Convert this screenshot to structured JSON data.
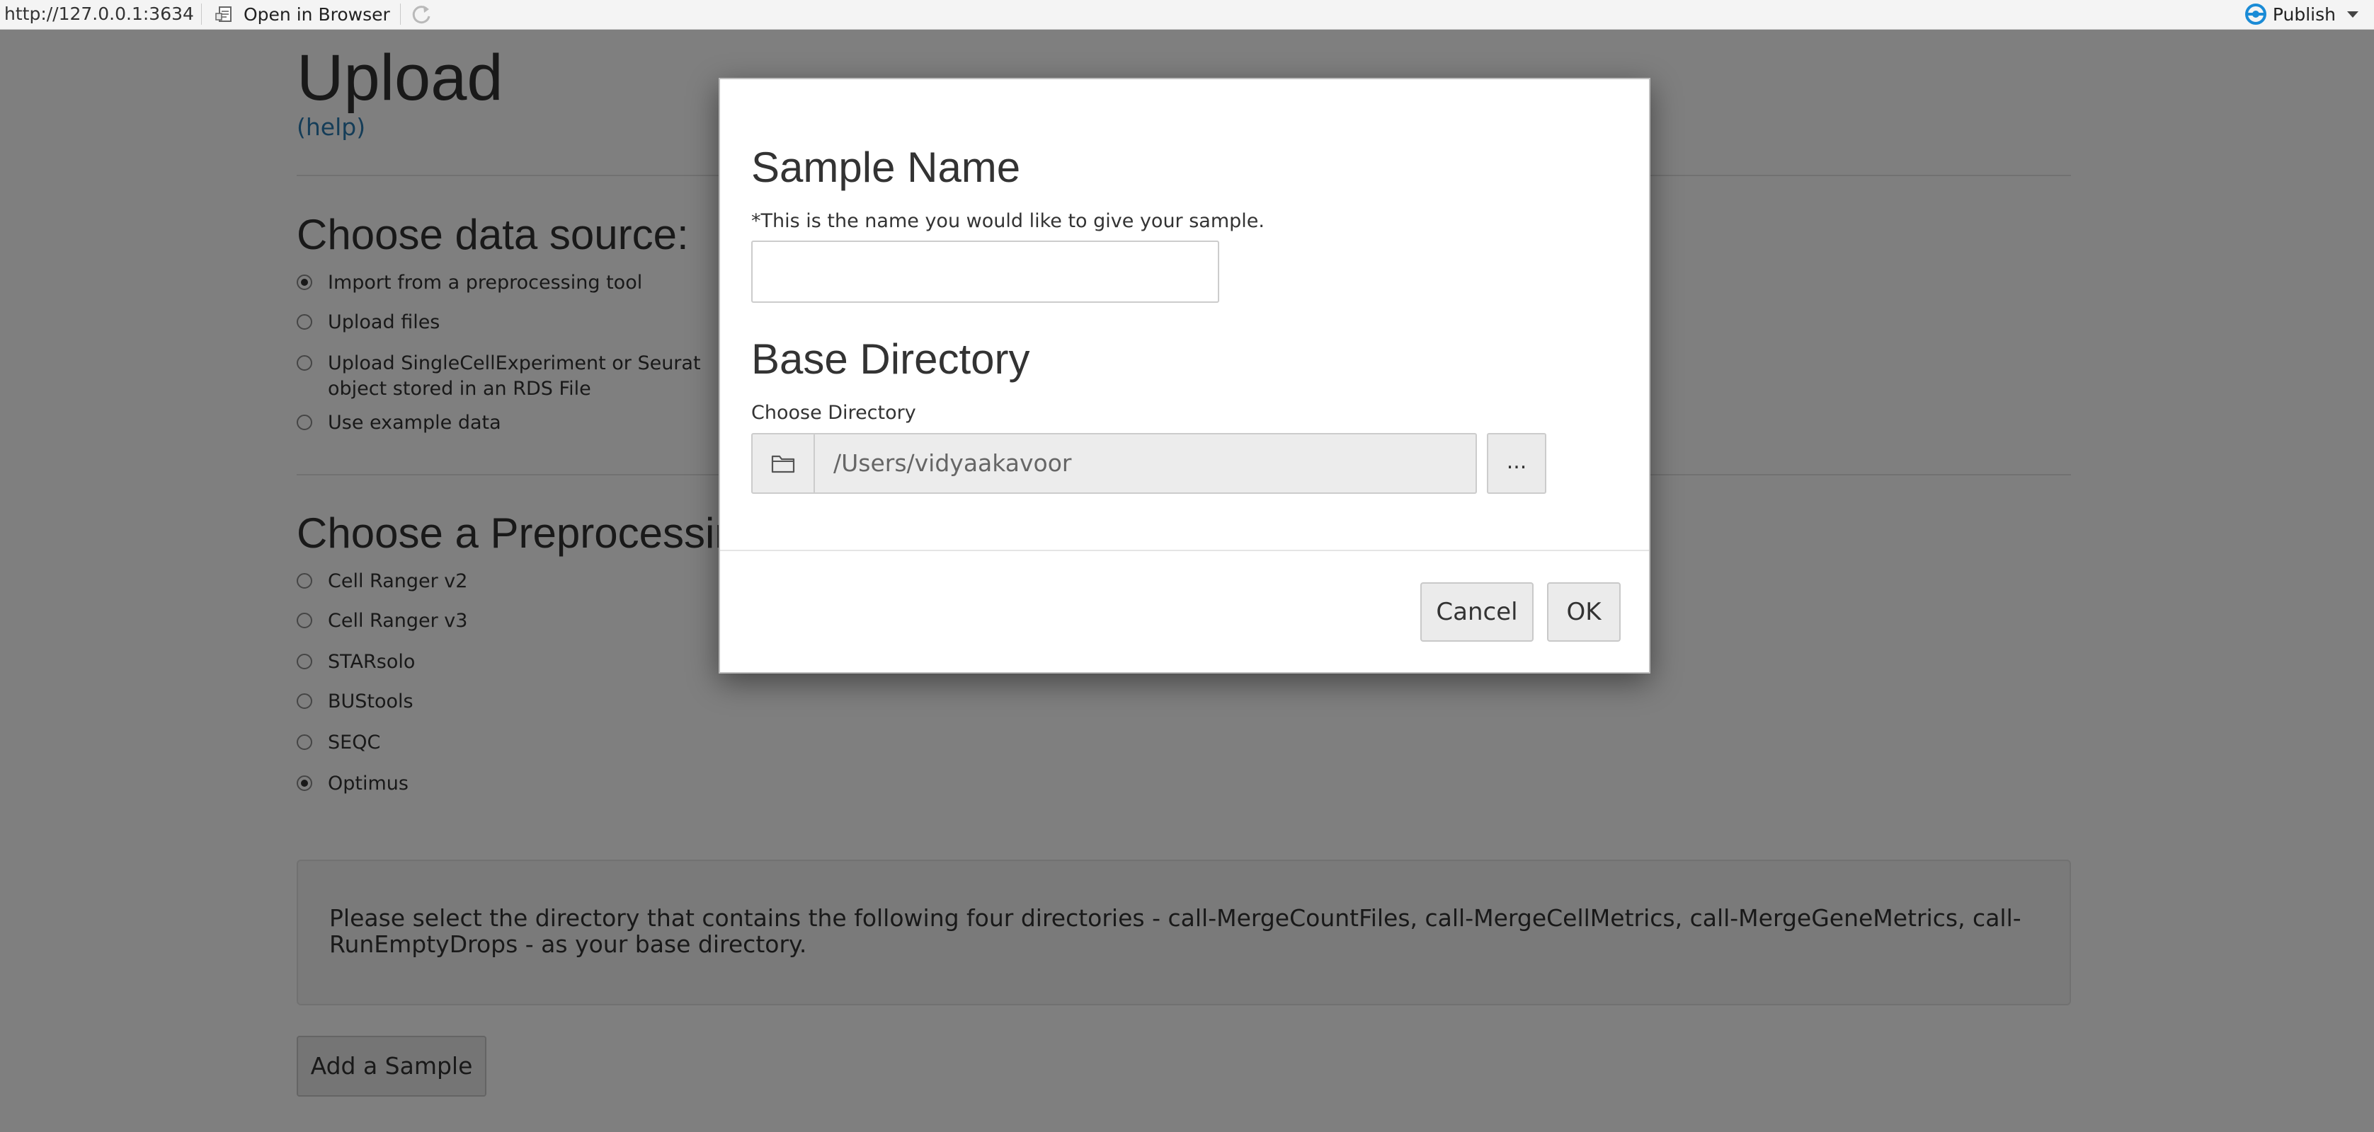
{
  "toolbar": {
    "url": "http://127.0.0.1:3634",
    "open_in_browser": "Open in Browser",
    "publish": "Publish"
  },
  "page": {
    "title": "Upload",
    "help_link": "(help)",
    "data_source": {
      "heading": "Choose data source:",
      "options": [
        {
          "label": "Import from a preprocessing tool",
          "checked": true
        },
        {
          "label": "Upload files",
          "checked": false
        },
        {
          "label": "Upload SingleCellExperiment or Seurat object stored in an RDS File",
          "checked": false
        },
        {
          "label": "Use example data",
          "checked": false
        }
      ]
    },
    "preprocessing": {
      "heading": "Choose a Preprocessing Tool:",
      "options": [
        {
          "label": "Cell Ranger v2",
          "checked": false
        },
        {
          "label": "Cell Ranger v3",
          "checked": false
        },
        {
          "label": "STARsolo",
          "checked": false
        },
        {
          "label": "BUStools",
          "checked": false
        },
        {
          "label": "SEQC",
          "checked": false
        },
        {
          "label": "Optimus",
          "checked": true
        }
      ]
    },
    "instructions": "Please select the directory that contains the following four directories - call-MergeCountFiles, call-MergeCellMetrics, call-MergeGeneMetrics, call-RunEmptyDrops - as your base directory.",
    "add_sample_button": "Add a Sample"
  },
  "modal": {
    "sample_name_heading": "Sample Name",
    "sample_name_hint": "*This is the name you would like to give your sample.",
    "sample_name_value": "",
    "base_dir_heading": "Base Directory",
    "choose_dir_label": "Choose Directory",
    "dir_path": "/Users/vidyaakavoor",
    "browse_button": "...",
    "cancel_button": "Cancel",
    "ok_button": "OK"
  },
  "colors": {
    "link": "#2a7ab0",
    "backdrop": "rgba(0,0,0,0.5)",
    "publish_icon": "#1a8bd6"
  },
  "icons": [
    "document-icon",
    "refresh-icon",
    "publish-icon",
    "folder-icon"
  ]
}
